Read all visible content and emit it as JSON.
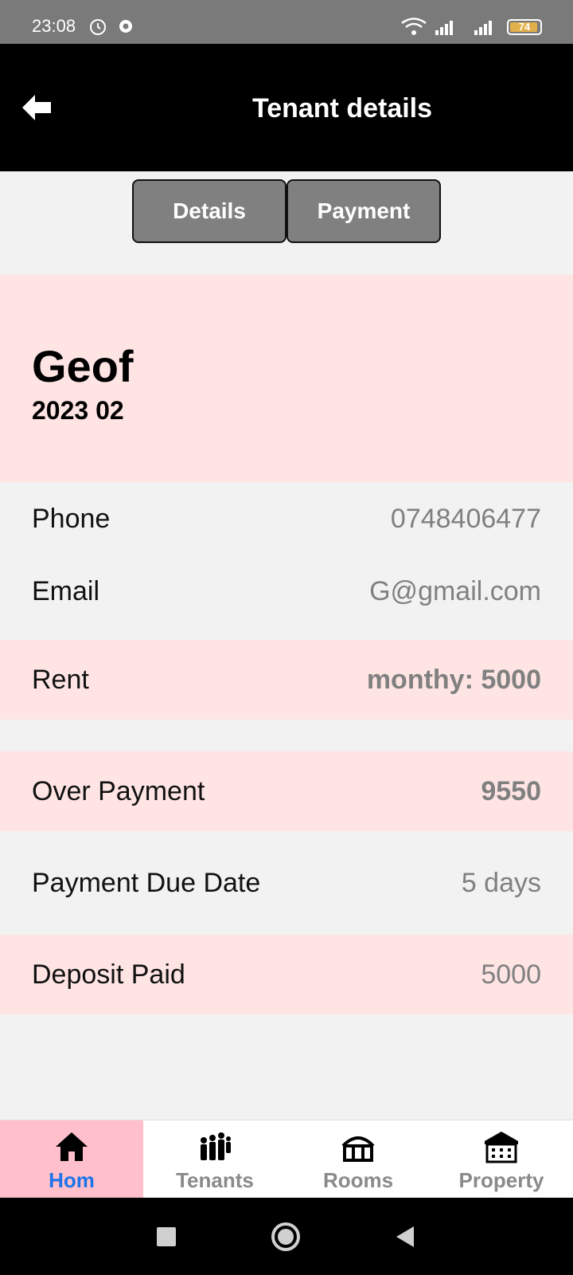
{
  "status_bar": {
    "time": "23:08",
    "battery": "74"
  },
  "app_bar": {
    "title": "Tenant details"
  },
  "tabs": [
    {
      "label": "Details"
    },
    {
      "label": "Payment"
    }
  ],
  "tenant": {
    "name": "Geof",
    "period": "2023 02"
  },
  "details": {
    "phone": {
      "label": "Phone",
      "value": "0748406477"
    },
    "email": {
      "label": "Email",
      "value": "G@gmail.com"
    },
    "rent": {
      "label": "Rent",
      "value": "monthy: 5000"
    },
    "over_payment": {
      "label": "Over Payment",
      "value": "9550"
    },
    "due_date": {
      "label": "Payment Due Date",
      "value": "5 days"
    },
    "deposit": {
      "label": "Deposit Paid",
      "value": "5000"
    }
  },
  "bottom_nav": [
    {
      "label": "Hom",
      "icon": "home-icon",
      "active": true
    },
    {
      "label": "Tenants",
      "icon": "people-icon",
      "active": false
    },
    {
      "label": "Rooms",
      "icon": "rooms-icon",
      "active": false
    },
    {
      "label": "Property",
      "icon": "property-icon",
      "active": false
    }
  ],
  "colors": {
    "accent": "#1e74e8",
    "pink_row": "#ffe4e4",
    "active_tab_bg": "#ffc0cb"
  }
}
